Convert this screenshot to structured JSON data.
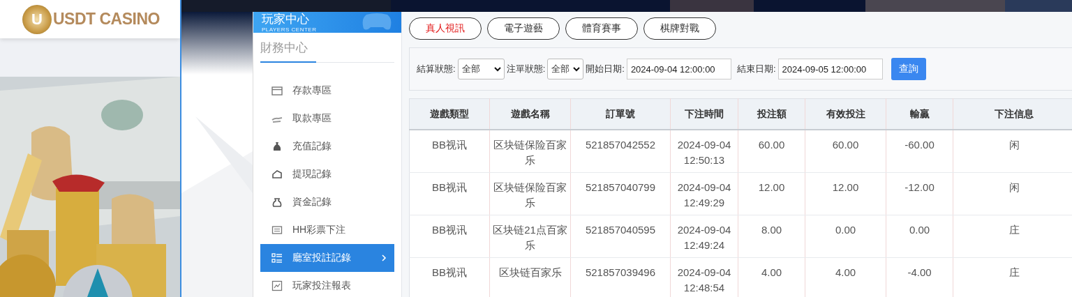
{
  "logo": {
    "mark": "U",
    "text": "USDT CASINO"
  },
  "sidebar": {
    "title": "玩家中心",
    "subtitle": "PLAYERS CENTER",
    "section": "財務中心",
    "items": [
      {
        "label": "存款專區",
        "selected": false
      },
      {
        "label": "取款專區",
        "selected": false
      },
      {
        "label": "充值記錄",
        "selected": false
      },
      {
        "label": "提現記錄",
        "selected": false
      },
      {
        "label": "資金記錄",
        "selected": false
      },
      {
        "label": "HH彩票下注",
        "selected": false
      },
      {
        "label": "廳室投註記錄",
        "selected": true
      },
      {
        "label": "玩家投注報表",
        "selected": false
      }
    ]
  },
  "categories": [
    {
      "label": "真人視訊",
      "selected": true
    },
    {
      "label": "電子遊藝",
      "selected": false
    },
    {
      "label": "體育賽事",
      "selected": false
    },
    {
      "label": "棋牌對戰",
      "selected": false
    }
  ],
  "filters": {
    "settle_status": {
      "label": "結算狀態:",
      "value": "全部"
    },
    "order_status": {
      "label": "注單狀態:",
      "value": "全部"
    },
    "start_date": {
      "label": "開始日期:",
      "value": "2024-09-04 12:00:00"
    },
    "end_date": {
      "label": "結束日期:",
      "value": "2024-09-05 12:00:00"
    },
    "query_button": "查詢"
  },
  "table": {
    "columns": [
      "遊戲類型",
      "遊戲名稱",
      "訂單號",
      "下注時間",
      "投注額",
      "有效投注",
      "輸贏",
      "下注信息"
    ],
    "rows": [
      [
        "BB视讯",
        "区块链保险百家乐",
        "521857042552",
        "2024-09-04 12:50:13",
        "60.00",
        "60.00",
        "-60.00",
        "闲"
      ],
      [
        "BB视讯",
        "区块链保险百家乐",
        "521857040799",
        "2024-09-04 12:49:29",
        "12.00",
        "12.00",
        "-12.00",
        "闲"
      ],
      [
        "BB视讯",
        "区块链21点百家乐",
        "521857040595",
        "2024-09-04 12:49:24",
        "8.00",
        "0.00",
        "0.00",
        "庄"
      ],
      [
        "BB视讯",
        "区块链百家乐",
        "521857039496",
        "2024-09-04 12:48:54",
        "4.00",
        "4.00",
        "-4.00",
        "庄"
      ]
    ]
  }
}
